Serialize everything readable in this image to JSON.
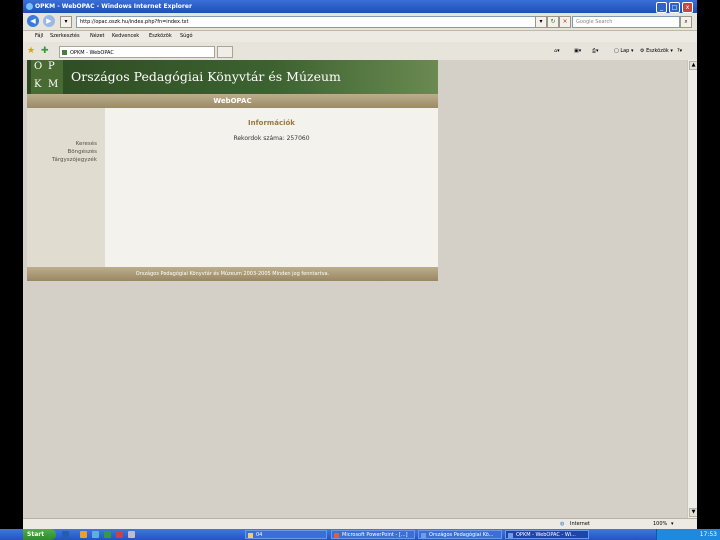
{
  "window": {
    "title": "OPKM - WebOPAC - Windows Internet Explorer",
    "minimize": "_",
    "maximize": "□",
    "close": "x"
  },
  "addressbar": {
    "url": "http://opac.oszk.hu/index.php?fn=index.txt",
    "search_placeholder": "Google Search"
  },
  "menu": [
    "Fájl",
    "Szerkesztés",
    "Nézet",
    "Kedvencek",
    "Eszközök",
    "Súgó"
  ],
  "tab": {
    "title": "OPKM - WebOPAC"
  },
  "commandbar": {
    "page": "Lap",
    "tools": "Eszközök"
  },
  "banner": {
    "logo_letters": [
      "O",
      "P",
      "K",
      "M"
    ],
    "title": "Országos Pedagógiai Könyvtár és Múzeum",
    "subtitle": "WebOPAC"
  },
  "sidebar": {
    "links": [
      "Keresés",
      "Böngészés",
      "Tárgyszójegyzék"
    ]
  },
  "content": {
    "heading": "Információk",
    "record_count": "Rekordok száma: 257060"
  },
  "footer": {
    "text": "Országos Pedagógiai Könyvtár és Múzeum 2003-2005 Minden jog fenntartva."
  },
  "statusbar": {
    "zone": "Internet",
    "zoom": "100%"
  },
  "taskbar": {
    "start": "Start",
    "tasks": [
      "04",
      "Microsoft PowerPoint - [...]",
      "Országos Pedagógiai Kö...",
      "OPKM - WebOPAC - Wi..."
    ],
    "clock": "17:53"
  }
}
